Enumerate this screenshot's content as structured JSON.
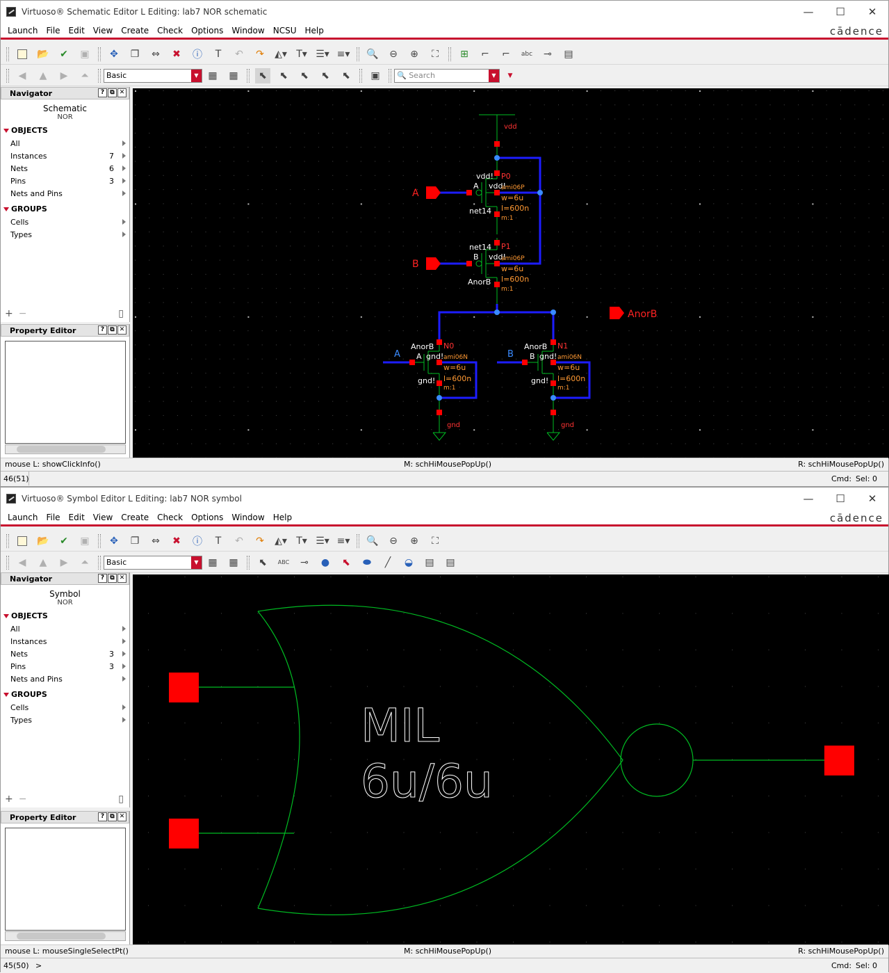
{
  "colors": {
    "accent": "#c8102e",
    "wire": "#1d1dff",
    "pin": "#ff0000",
    "device": "#00bb22",
    "label_orange": "#ff9933"
  },
  "menus": [
    "Launch",
    "File",
    "Edit",
    "View",
    "Create",
    "Check",
    "Options",
    "Window",
    "NCSU",
    "Help"
  ],
  "menus2": [
    "Launch",
    "File",
    "Edit",
    "View",
    "Create",
    "Check",
    "Options",
    "Window",
    "Help"
  ],
  "brand": "cādence",
  "win_buttons": {
    "min": "—",
    "max": "☐",
    "close": "✕"
  },
  "schematic": {
    "title": "Virtuoso® Schematic Editor L Editing: lab7 NOR schematic",
    "toolbar_select": "Basic",
    "search_placeholder": "Search",
    "navigator": {
      "title": "Navigator",
      "cell_type": "Schematic",
      "cell_name": "NOR",
      "objects_header": "OBJECTS",
      "objects": [
        {
          "label": "All",
          "count": ""
        },
        {
          "label": "Instances",
          "count": "7"
        },
        {
          "label": "Nets",
          "count": "6"
        },
        {
          "label": "Pins",
          "count": "3"
        },
        {
          "label": "Nets and Pins",
          "count": ""
        }
      ],
      "groups_header": "GROUPS",
      "groups": [
        {
          "label": "Cells"
        },
        {
          "label": "Types"
        }
      ]
    },
    "property_editor": "Property Editor",
    "status": {
      "left": "mouse L: showClickInfo()",
      "mid": "M: schHiMousePopUp()",
      "right": "R: schHiMousePopUp()"
    },
    "cmdline": {
      "num": "46(51)",
      "prompt": "",
      "cmd": "Cmd:",
      "sel": "Sel: 0"
    },
    "labels": {
      "vdd": "vdd",
      "gnd": "gnd",
      "pinA": "A",
      "pinB": "B",
      "pinOut": "AnorB",
      "P0": "P0",
      "P1": "P1",
      "N0": "N0",
      "N1": "N1",
      "model_p": "ami06P",
      "model_n": "ami06N",
      "w": "w=6u",
      "l": "l=600n",
      "m": "m:1",
      "vddbang": "vdd!",
      "gndbang": "gnd!",
      "net14": "net14",
      "anorb": "AnorB",
      "a": "A",
      "b": "B"
    }
  },
  "symbol": {
    "title": "Virtuoso® Symbol Editor L Editing: lab7 NOR symbol",
    "toolbar_select": "Basic",
    "navigator": {
      "title": "Navigator",
      "cell_type": "Symbol",
      "cell_name": "NOR",
      "objects_header": "OBJECTS",
      "objects": [
        {
          "label": "All",
          "count": ""
        },
        {
          "label": "Instances",
          "count": ""
        },
        {
          "label": "Nets",
          "count": "3"
        },
        {
          "label": "Pins",
          "count": "3"
        },
        {
          "label": "Nets and Pins",
          "count": ""
        }
      ],
      "groups_header": "GROUPS",
      "groups": [
        {
          "label": "Cells"
        },
        {
          "label": "Types"
        }
      ]
    },
    "property_editor": "Property Editor",
    "label_line1": "MIL",
    "label_line2": "6u/6u",
    "status": {
      "left": "mouse L: mouseSingleSelectPt()",
      "mid": "M: schHiMousePopUp()",
      "right": "R: schHiMousePopUp()"
    },
    "cmdline": {
      "num": "45(50)",
      "prompt": ">",
      "cmd": "Cmd:",
      "sel": "Sel: 0"
    }
  }
}
